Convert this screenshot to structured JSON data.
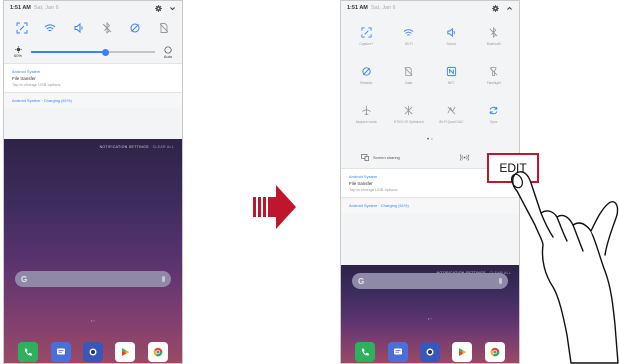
{
  "left_phone": {
    "status_bar": {
      "time": "1:51 AM",
      "date": "Sat, Jan 6"
    },
    "brightness": {
      "label": "60%",
      "value": 0.6,
      "auto_label": "Auto"
    },
    "notifications": {
      "app_name": "Android System",
      "title": "File transfer",
      "text": "Tap to change USB options",
      "system": "Android System · Charging (61%)"
    },
    "home": {
      "notification_settings": "NOTIFICATION SETTINGS",
      "clear_all": "CLEAR ALL"
    }
  },
  "right_phone": {
    "status_bar": {
      "time": "1:51 AM",
      "date": "Sat, Jan 6"
    },
    "quick_settings": [
      {
        "label": "Capture+",
        "icon": "capture-icon"
      },
      {
        "label": "Wi-Fi",
        "icon": "wifi-icon"
      },
      {
        "label": "Sound",
        "icon": "sound-icon"
      },
      {
        "label": "Bluetooth",
        "icon": "bluetooth-icon"
      },
      {
        "label": "Rotation",
        "icon": "rotation-icon"
      },
      {
        "label": "Data",
        "icon": "data-icon"
      },
      {
        "label": "NFC",
        "icon": "nfc-icon"
      },
      {
        "label": "Flashlight",
        "icon": "flashlight-icon"
      },
      {
        "label": "Airplane mode",
        "icon": "airplane-icon"
      },
      {
        "label": "STICK IR Optimized",
        "icon": "stick-icon"
      },
      {
        "label": "Wi-Fi Quad DAC",
        "icon": "dac-icon"
      },
      {
        "label": "Sync",
        "icon": "sync-icon"
      }
    ],
    "screen_sharing": "Screen sharing",
    "notifications": {
      "app_name": "Android System",
      "title": "File transfer",
      "text": "Tap to change USB options",
      "system": "Android System · Charging (61%)"
    },
    "home": {
      "notification_settings": "NOTIFICATION SETTINGS",
      "clear_all": "CLEAR ALL"
    }
  },
  "edit_label": "EDIT",
  "colors": {
    "accent": "#3b82f6",
    "edit_border": "#c0162d",
    "arrow": "#c0162d"
  }
}
